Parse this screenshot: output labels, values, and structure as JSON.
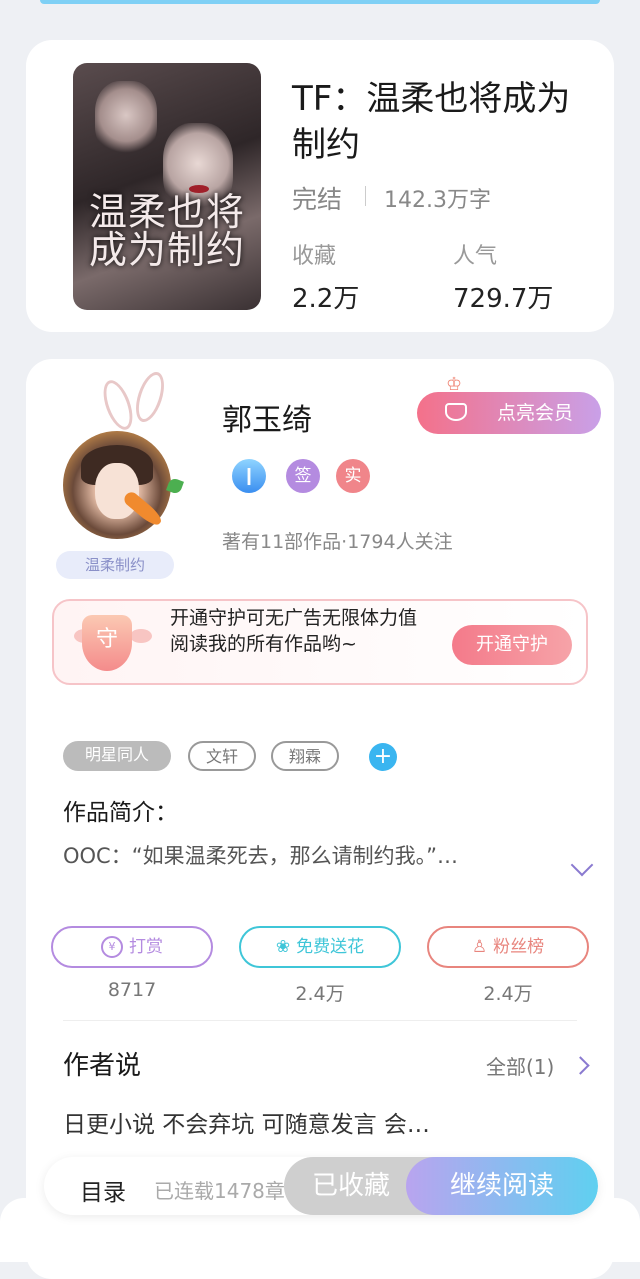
{
  "book": {
    "title": "TF：温柔也将成为制约",
    "status": "完结",
    "word_count": "142.3万字",
    "stats": [
      {
        "label": "收藏",
        "value": "2.2万"
      },
      {
        "label": "人气",
        "value": "729.7万"
      }
    ],
    "cover": {
      "title_text": "温柔也将成为制约"
    }
  },
  "author": {
    "name": "郭玉绮",
    "vip_button": "点亮会员",
    "badges": [
      "签",
      "实"
    ],
    "meta": "著有11部作品·1794人关注",
    "fan_tag": "温柔制约"
  },
  "guard": {
    "shield_glyph": "守",
    "text": "开通守护可无广告无限体力值阅读我的所有作品哟~",
    "button": "开通守护"
  },
  "tags": [
    "明星同人",
    "文轩",
    "翔霖"
  ],
  "intro": {
    "title": "作品简介：",
    "text": "OOC：“如果温柔死去，那么请制约我。”…"
  },
  "actions": [
    {
      "label": "打赏",
      "count": "8717",
      "color": "#b48be0"
    },
    {
      "label": "免费送花",
      "count": "2.4万",
      "color": "#3fc6d8"
    },
    {
      "label": "粉丝榜",
      "count": "2.4万",
      "color": "#e8857e"
    }
  ],
  "author_says": {
    "title": "作者说",
    "all_label": "全部(1)",
    "text": "日更小说 不会弃坑 可随意发言 会…"
  },
  "bottom_bar": {
    "toc": "目录",
    "serial": "已连载1478章",
    "favorite": "已收藏",
    "continue": "继续阅读"
  }
}
